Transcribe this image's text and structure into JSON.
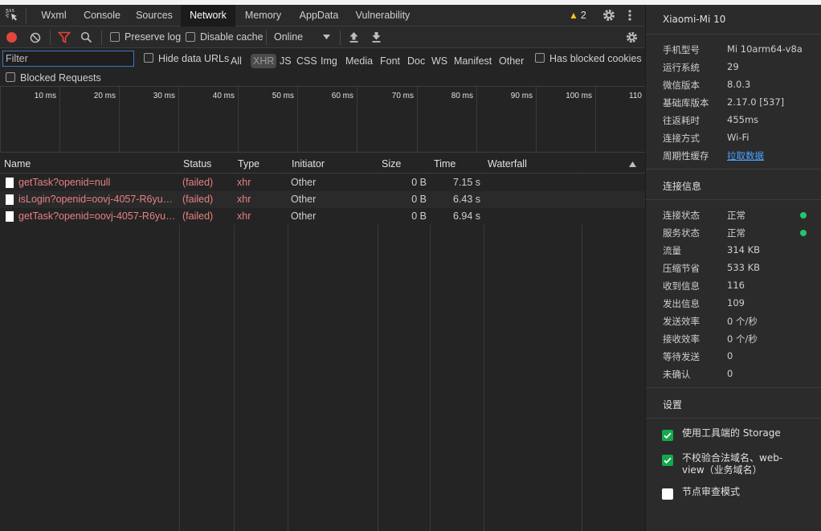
{
  "tabs": [
    "Wxml",
    "Console",
    "Sources",
    "Network",
    "Memory",
    "AppData",
    "Vulnerability"
  ],
  "active_tab": "Network",
  "warning_count": "2",
  "toolbar": {
    "preserve_log": "Preserve log",
    "disable_cache": "Disable cache",
    "throttle": "Online"
  },
  "filter": {
    "placeholder": "Filter",
    "hide_data_urls": "Hide data URLs",
    "types": [
      "All",
      "XHR",
      "JS",
      "CSS",
      "Img",
      "Media",
      "Font",
      "Doc",
      "WS",
      "Manifest",
      "Other"
    ],
    "active_type": "XHR",
    "has_blocked_cookies": "Has blocked cookies",
    "blocked_requests": "Blocked Requests"
  },
  "timeline_ticks": [
    "10 ms",
    "20 ms",
    "30 ms",
    "40 ms",
    "50 ms",
    "60 ms",
    "70 ms",
    "80 ms",
    "90 ms",
    "100 ms",
    "110"
  ],
  "table": {
    "headers": [
      "Name",
      "Status",
      "Type",
      "Initiator",
      "Size",
      "Time",
      "Waterfall"
    ],
    "rows": [
      {
        "name": "getTask?openid=null",
        "status": "(failed)",
        "type": "xhr",
        "initiator": "Other",
        "size": "0 B",
        "time": "7.15 s"
      },
      {
        "name": "isLogin?openid=oovj-4057-R6yumi...",
        "status": "(failed)",
        "type": "xhr",
        "initiator": "Other",
        "size": "0 B",
        "time": "6.43 s"
      },
      {
        "name": "getTask?openid=oovj-4057-R6yum...",
        "status": "(failed)",
        "type": "xhr",
        "initiator": "Other",
        "size": "0 B",
        "time": "6.94 s"
      }
    ]
  },
  "side": {
    "device": "Xiaomi-Mi 10",
    "info": [
      {
        "k": "手机型号",
        "v": "Mi 10arm64-v8a"
      },
      {
        "k": "运行系统",
        "v": "29"
      },
      {
        "k": "微信版本",
        "v": "8.0.3"
      },
      {
        "k": "基础库版本",
        "v": "2.17.0 [537]"
      },
      {
        "k": "往返耗时",
        "v": "455ms"
      },
      {
        "k": "连接方式",
        "v": "Wi-Fi"
      },
      {
        "k": "周期性缓存",
        "v": "拉取数据"
      }
    ],
    "conn_title": "连接信息",
    "conn": [
      {
        "k": "连接状态",
        "v": "正常"
      },
      {
        "k": "服务状态",
        "v": "正常"
      },
      {
        "k": "流量",
        "v": "314 KB"
      },
      {
        "k": "压缩节省",
        "v": "533 KB"
      },
      {
        "k": "收到信息",
        "v": "116"
      },
      {
        "k": "发出信息",
        "v": "109"
      },
      {
        "k": "发送效率",
        "v": "0 个/秒"
      },
      {
        "k": "接收效率",
        "v": "0 个/秒"
      },
      {
        "k": "等待发送",
        "v": "0"
      },
      {
        "k": "未确认",
        "v": "0"
      }
    ],
    "settings_title": "设置",
    "settings": [
      {
        "label": "使用工具端的 Storage",
        "checked": true
      },
      {
        "label": "不校验合法域名、web-view（业务域名）",
        "checked": true
      },
      {
        "label": "节点审查模式",
        "checked": false
      }
    ]
  }
}
